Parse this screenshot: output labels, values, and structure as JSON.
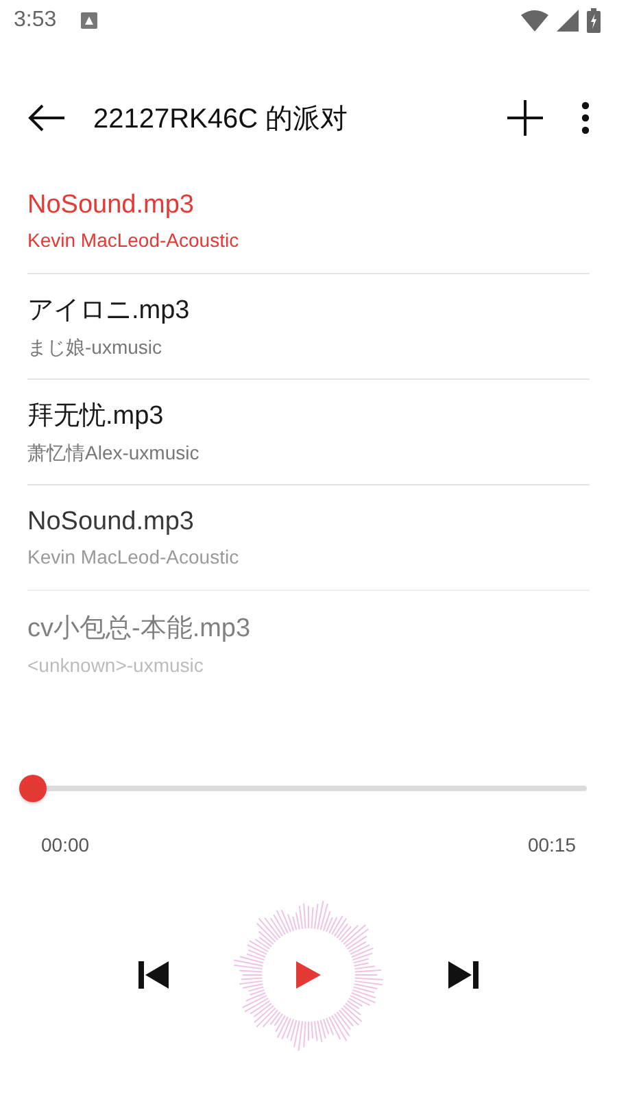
{
  "status_bar": {
    "time": "3:53"
  },
  "toolbar": {
    "title": "22127RK46C 的派对"
  },
  "songs": [
    {
      "title": "NoSound.mp3",
      "subtitle": "Kevin MacLeod-Acoustic",
      "selected": true
    },
    {
      "title": "アイロニ.mp3",
      "subtitle": "まじ娘-uxmusic",
      "selected": false
    },
    {
      "title": "拜无忧.mp3",
      "subtitle": "萧忆情Alex-uxmusic",
      "selected": false
    },
    {
      "title": "NoSound.mp3",
      "subtitle": "Kevin MacLeod-Acoustic",
      "selected": false
    },
    {
      "title": "cv小包总-本能.mp3",
      "subtitle": "<unknown>-uxmusic",
      "selected": false
    }
  ],
  "player": {
    "level": 0,
    "elapsed": "00:00",
    "duration": "00:15"
  }
}
